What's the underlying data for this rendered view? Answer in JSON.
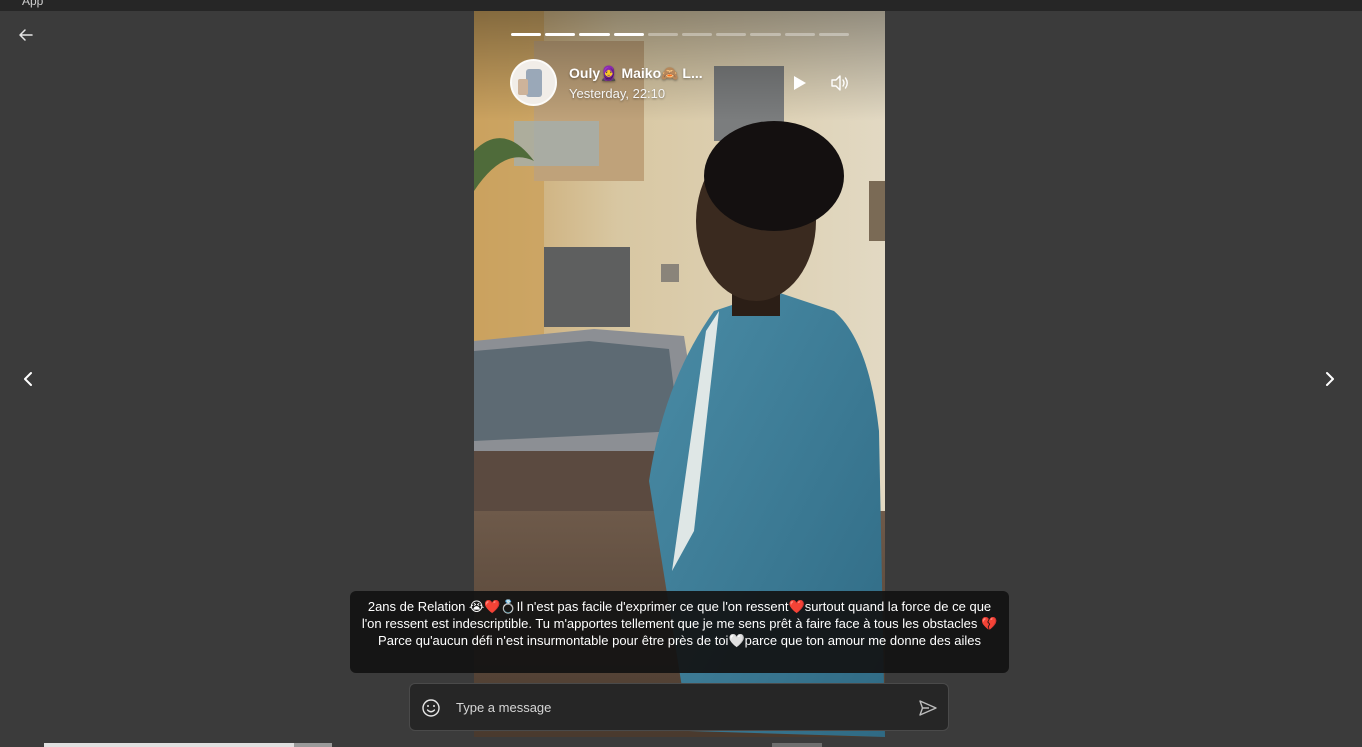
{
  "window": {
    "title_fragment": "App"
  },
  "story": {
    "segments_total": 10,
    "segments_completed": 4,
    "sender_name": "Ouly🧕 Maiko🙈 L...",
    "timestamp": "Yesterday, 22:10",
    "caption": "2ans de Relation 😭❤️💍Il n'est pas facile d'exprimer ce que l'on ressent❤️surtout quand la force de ce que l'on ressent est indescriptible. Tu m'apportes tellement que je me sens prêt à faire face à tous les obstacles 💔Parce qu'aucun défi n'est insurmontable pour être près de toi🤍parce que ton amour me donne des ailes"
  },
  "composer": {
    "placeholder": "Type a message"
  },
  "icons": {
    "back": "arrow-left-icon",
    "prev": "chevron-left-icon",
    "next": "chevron-right-icon",
    "play": "play-icon",
    "volume": "volume-icon",
    "emoji": "emoji-icon",
    "send": "send-icon"
  },
  "colors": {
    "background": "#3b3b3b",
    "caption_bg": "#121212",
    "composer_bg": "#262626"
  }
}
